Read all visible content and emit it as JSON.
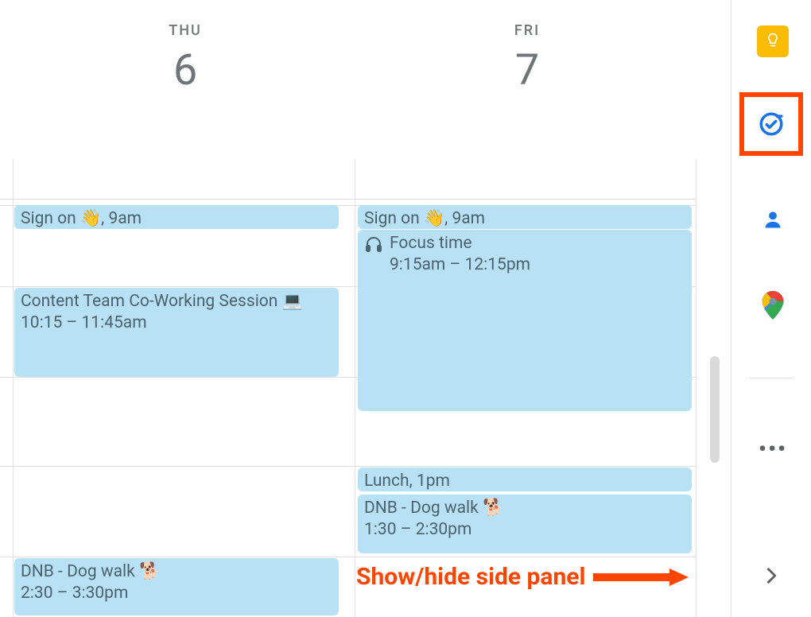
{
  "days": {
    "thu": {
      "dow": "THU",
      "num": "6"
    },
    "fri": {
      "dow": "FRI",
      "num": "7"
    }
  },
  "events": {
    "thu_signon": {
      "line": "Sign on 👋, 9am"
    },
    "thu_coworking_title": "Content Team Co-Working Session 💻",
    "thu_coworking_time": "10:15 – 11:45am",
    "thu_dog_title": "DNB - Dog walk 🐕",
    "thu_dog_time": "2:30 – 3:30pm",
    "fri_signon": {
      "line": "Sign on 👋, 9am"
    },
    "fri_focus_title": "Focus time",
    "fri_focus_time": "9:15am – 12:15pm",
    "fri_lunch": "Lunch, 1pm",
    "fri_dog_title": "DNB - Dog walk 🐕",
    "fri_dog_time": "1:30 – 2:30pm"
  },
  "sidepanel": {
    "keep": "keep-icon",
    "tasks": "tasks-icon",
    "contacts": "contacts-icon",
    "maps": "maps-icon",
    "addons": "•••",
    "chevron": "chevron-right-icon"
  },
  "annotation": "Show/hide side panel"
}
